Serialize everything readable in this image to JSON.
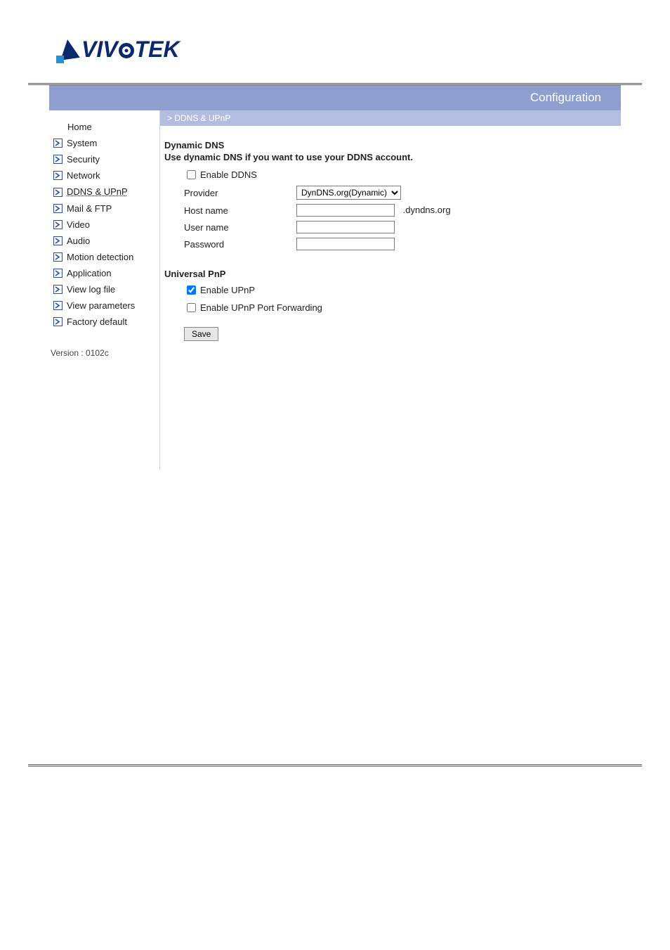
{
  "brand": "VIVOTEK",
  "topbar_title": "Configuration",
  "breadcrumb": "> DDNS & UPnP",
  "sidebar": {
    "home": "Home",
    "items": [
      {
        "label": "System"
      },
      {
        "label": "Security"
      },
      {
        "label": "Network"
      },
      {
        "label": "DDNS & UPnP",
        "active": true
      },
      {
        "label": "Mail & FTP"
      },
      {
        "label": "Video"
      },
      {
        "label": "Audio"
      },
      {
        "label": "Motion detection"
      },
      {
        "label": "Application"
      },
      {
        "label": "View log file"
      },
      {
        "label": "View parameters"
      },
      {
        "label": "Factory default"
      }
    ],
    "version": "Version : 0102c"
  },
  "ddns": {
    "heading": "Dynamic DNS",
    "subtitle": "Use dynamic DNS if you want to use your DDNS account.",
    "enable_label": "Enable DDNS",
    "enable_checked": false,
    "provider_label": "Provider",
    "provider_value": "DynDNS.org(Dynamic)",
    "hostname_label": "Host name",
    "hostname_value": "",
    "hostname_suffix": ".dyndns.org",
    "username_label": "User name",
    "username_value": "",
    "password_label": "Password",
    "password_value": ""
  },
  "upnp": {
    "heading": "Universal PnP",
    "enable_label": "Enable UPnP",
    "enable_checked": true,
    "portfwd_label": "Enable UPnP Port Forwarding",
    "portfwd_checked": false
  },
  "save_label": "Save"
}
